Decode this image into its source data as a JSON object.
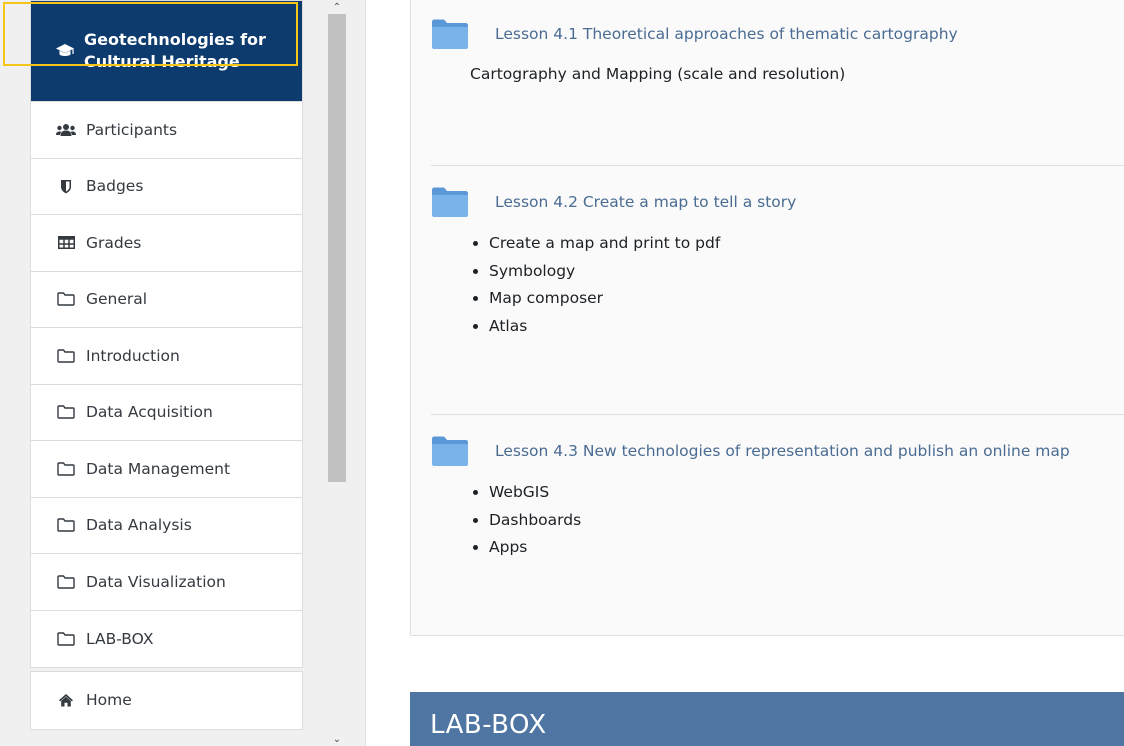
{
  "sidebar": {
    "course": {
      "label": "Geotechnologies for Cultural Heritage",
      "icon": "graduation-cap-icon"
    },
    "items": [
      {
        "label": "Participants",
        "icon": "users-icon"
      },
      {
        "label": "Badges",
        "icon": "shield-icon"
      },
      {
        "label": "Grades",
        "icon": "table-icon"
      },
      {
        "label": "General",
        "icon": "folder-icon"
      },
      {
        "label": "Introduction",
        "icon": "folder-icon"
      },
      {
        "label": "Data Acquisition",
        "icon": "folder-icon"
      },
      {
        "label": "Data Management",
        "icon": "folder-icon"
      },
      {
        "label": "Data Analysis",
        "icon": "folder-icon"
      },
      {
        "label": "Data Visualization",
        "icon": "folder-icon"
      },
      {
        "label": "LAB-BOX",
        "icon": "folder-icon"
      }
    ],
    "secondary": [
      {
        "label": "Home",
        "icon": "home-icon"
      }
    ]
  },
  "lessons": [
    {
      "title": "Lesson 4.1 Theoretical approaches of thematic cartography",
      "summary": "Cartography and Mapping (scale and resolution)"
    },
    {
      "title": "Lesson 4.2 Create a map to tell a story",
      "bullets": [
        "Create a map and print to pdf",
        "Symbology",
        "Map composer",
        "Atlas"
      ]
    },
    {
      "title": "Lesson 4.3 New technologies of representation and publish an online map",
      "bullets": [
        "WebGIS",
        "Dashboards",
        "Apps"
      ]
    }
  ],
  "next_section": {
    "title": "LAB-BOX"
  },
  "colors": {
    "active_nav": "#0e3b6e",
    "link": "#4a6c93",
    "section_banner": "#4f76a2",
    "focus": "#f5c518"
  }
}
